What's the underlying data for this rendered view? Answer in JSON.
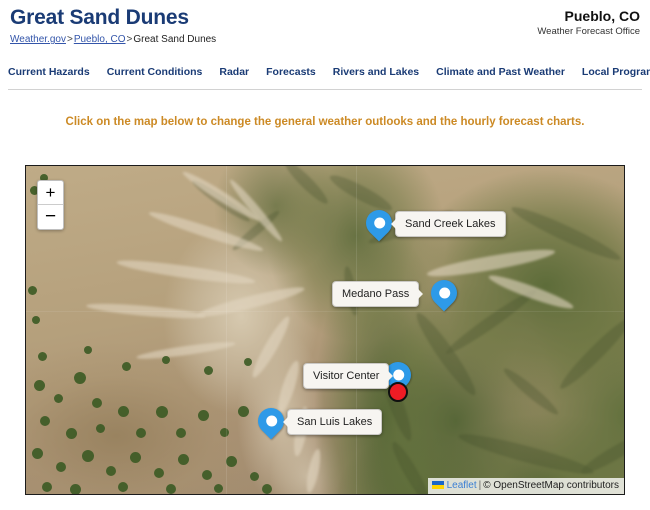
{
  "header": {
    "site_title": "Great Sand Dunes",
    "breadcrumb": {
      "items": [
        {
          "label": "Weather.gov",
          "link": true
        },
        {
          "label": "Pueblo, CO",
          "link": true
        },
        {
          "label": "Great Sand Dunes",
          "link": false
        }
      ],
      "separator": ">"
    },
    "office_name": "Pueblo, CO",
    "office_subtitle": "Weather Forecast Office"
  },
  "nav": {
    "items": [
      {
        "label": "Current Hazards"
      },
      {
        "label": "Current Conditions"
      },
      {
        "label": "Radar"
      },
      {
        "label": "Forecasts"
      },
      {
        "label": "Rivers and Lakes"
      },
      {
        "label": "Climate and Past Weather"
      },
      {
        "label": "Local Programs"
      }
    ]
  },
  "instruction": {
    "text": "Click on the map below to change the general weather outlooks and the hourly forecast charts.",
    "color": "#cc8a25"
  },
  "map": {
    "zoom_in_label": "+",
    "zoom_out_label": "−",
    "marker_color": "#2e9ae8",
    "selected_marker_color": "#ee1c24",
    "markers": [
      {
        "name": "Sand Creek Lakes",
        "label_side": "right"
      },
      {
        "name": "Medano Pass",
        "label_side": "left"
      },
      {
        "name": "Visitor Center",
        "label_side": "left",
        "selected": true
      },
      {
        "name": "San Luis Lakes",
        "label_side": "right"
      }
    ],
    "attribution": {
      "leaflet": "Leaflet",
      "separator": "|",
      "osm": "© OpenStreetMap contributors"
    }
  }
}
